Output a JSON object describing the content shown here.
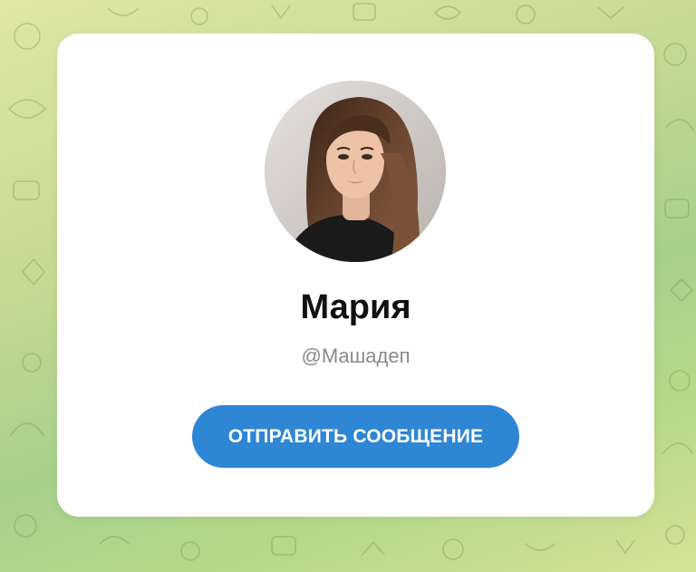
{
  "background": {
    "pattern_icon": "doodle-pattern-icon",
    "colors": [
      "#dfe6a6",
      "#a9cf8c",
      "#d4e394"
    ]
  },
  "profile": {
    "avatar_icon": "profile-photo",
    "name": "Мария",
    "username": "@Машадеп"
  },
  "actions": {
    "send_message_label": "ОТПРАВИТЬ СООБЩЕНИЕ",
    "button_color": "#2e86d4"
  }
}
